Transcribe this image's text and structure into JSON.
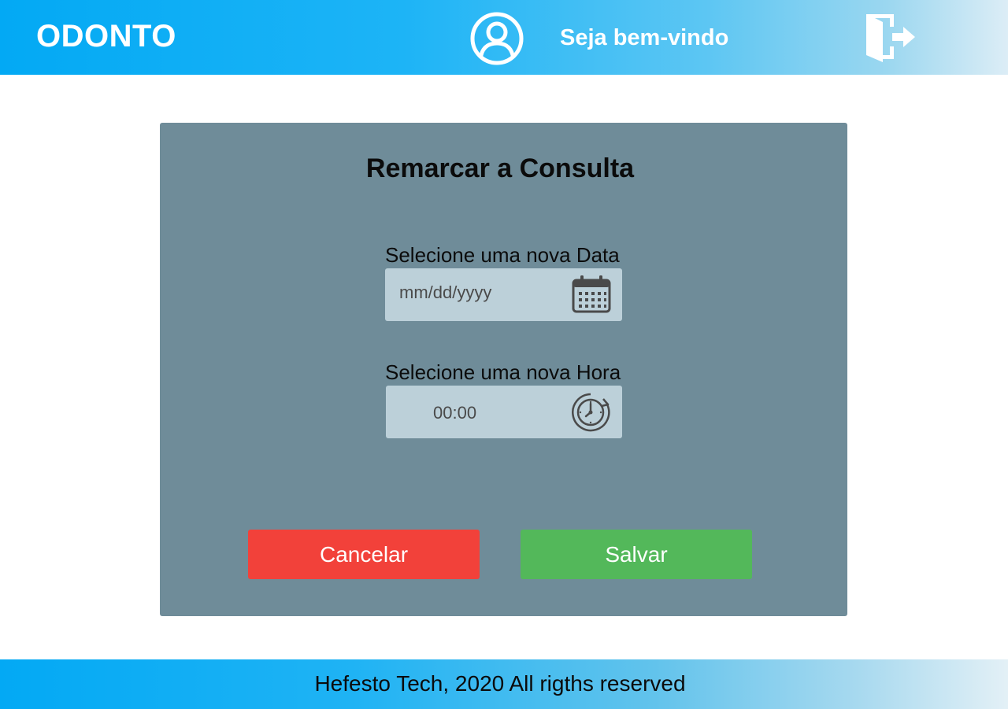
{
  "header": {
    "brand": "ODONTO",
    "welcome": "Seja bem-vindo",
    "user_icon": "user-circle-icon",
    "logout_icon": "logout-icon"
  },
  "form": {
    "title": "Remarcar a Consulta",
    "date_label": "Selecione uma nova Data",
    "date_placeholder": "mm/dd/yyyy",
    "date_icon": "calendar-icon",
    "time_label": "Selecione uma nova Hora",
    "time_value": "00:00",
    "time_icon": "clock-icon",
    "cancel_label": "Cancelar",
    "save_label": "Salvar"
  },
  "footer": {
    "text": "Hefesto Tech, 2020 All rigths reserved"
  },
  "colors": {
    "header_accent": "#03a9f4",
    "card_bg": "#6f8c99",
    "input_bg": "#bcd0d9",
    "cancel": "#f2413a",
    "save": "#53b85a"
  }
}
